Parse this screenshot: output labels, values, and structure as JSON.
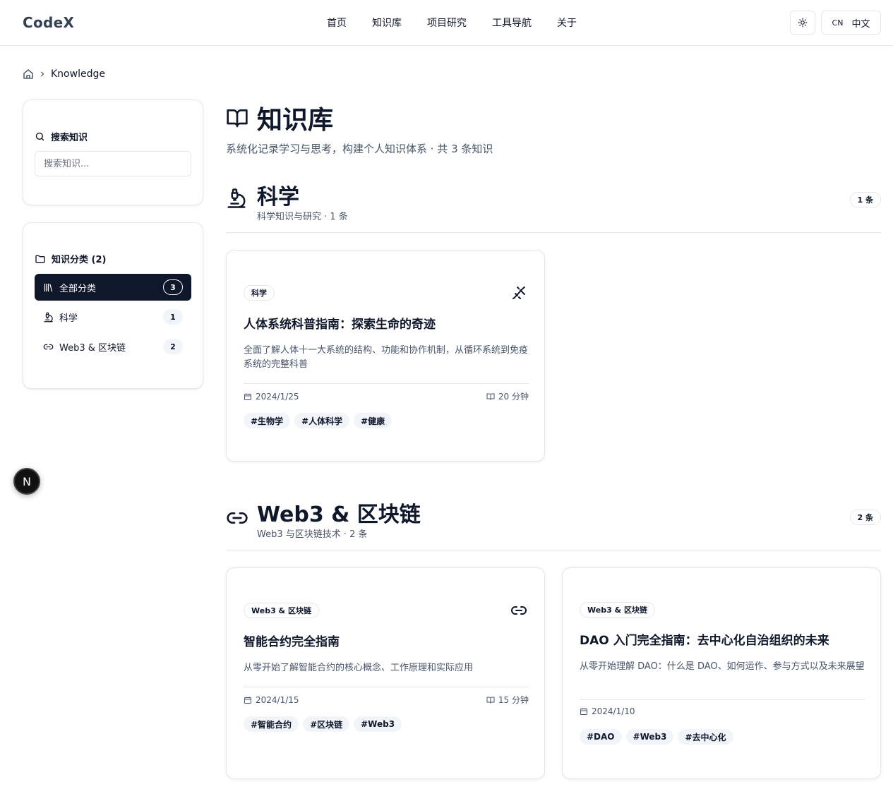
{
  "header": {
    "logo": "CodeX",
    "nav": [
      "首页",
      "知识库",
      "项目研究",
      "工具导航",
      "关于"
    ],
    "lang_code": "CN",
    "lang_label": "中文"
  },
  "breadcrumb": {
    "current": "Knowledge"
  },
  "sidebar": {
    "search_title": "搜索知识",
    "search_placeholder": "搜索知识...",
    "categories_title": "知识分类 (2)",
    "categories": [
      {
        "label": "全部分类",
        "count": "3",
        "icon": "library-icon",
        "active": true
      },
      {
        "label": "科学",
        "count": "1",
        "icon": "microscope-icon",
        "active": false
      },
      {
        "label": "Web3 & 区块链",
        "count": "2",
        "icon": "link-icon",
        "active": false
      }
    ]
  },
  "floating_badge": "N",
  "page": {
    "title": "知识库",
    "subtitle": "系统化记录学习与思考，构建个人知识体系 · 共 3 条知识"
  },
  "sections": [
    {
      "name": "科学",
      "desc": "科学知识与研究 · 1 条",
      "count": "1 条",
      "icon": "microscope-icon",
      "cards": [
        {
          "tag": "科学",
          "icon": "dna-icon",
          "title": "人体系统科普指南：探索生命的奇迹",
          "desc": "全面了解人体十一大系统的结构、功能和协作机制，从循环系统到免疫系统的完整科普",
          "date": "2024/1/25",
          "read_time": "20 分钟",
          "tags": [
            "#生物学",
            "#人体科学",
            "#健康"
          ]
        }
      ]
    },
    {
      "name": "Web3 & 区块链",
      "desc": "Web3 与区块链技术 · 2 条",
      "count": "2 条",
      "icon": "link-icon",
      "cards": [
        {
          "tag": "Web3 & 区块链",
          "icon": "link-icon",
          "title": "智能合约完全指南",
          "desc": "从零开始了解智能合约的核心概念、工作原理和实际应用",
          "date": "2024/1/15",
          "read_time": "15 分钟",
          "tags": [
            "#智能合约",
            "#区块链",
            "#Web3"
          ]
        },
        {
          "tag": "Web3 & 区块链",
          "title": "DAO 入门完全指南：去中心化自治组织的未来",
          "desc": "从零开始理解 DAO：什么是 DAO、如何运作、参与方式以及未来展望",
          "date": "2024/1/10",
          "tags": [
            "#DAO",
            "#Web3",
            "#去中心化"
          ]
        }
      ]
    }
  ]
}
